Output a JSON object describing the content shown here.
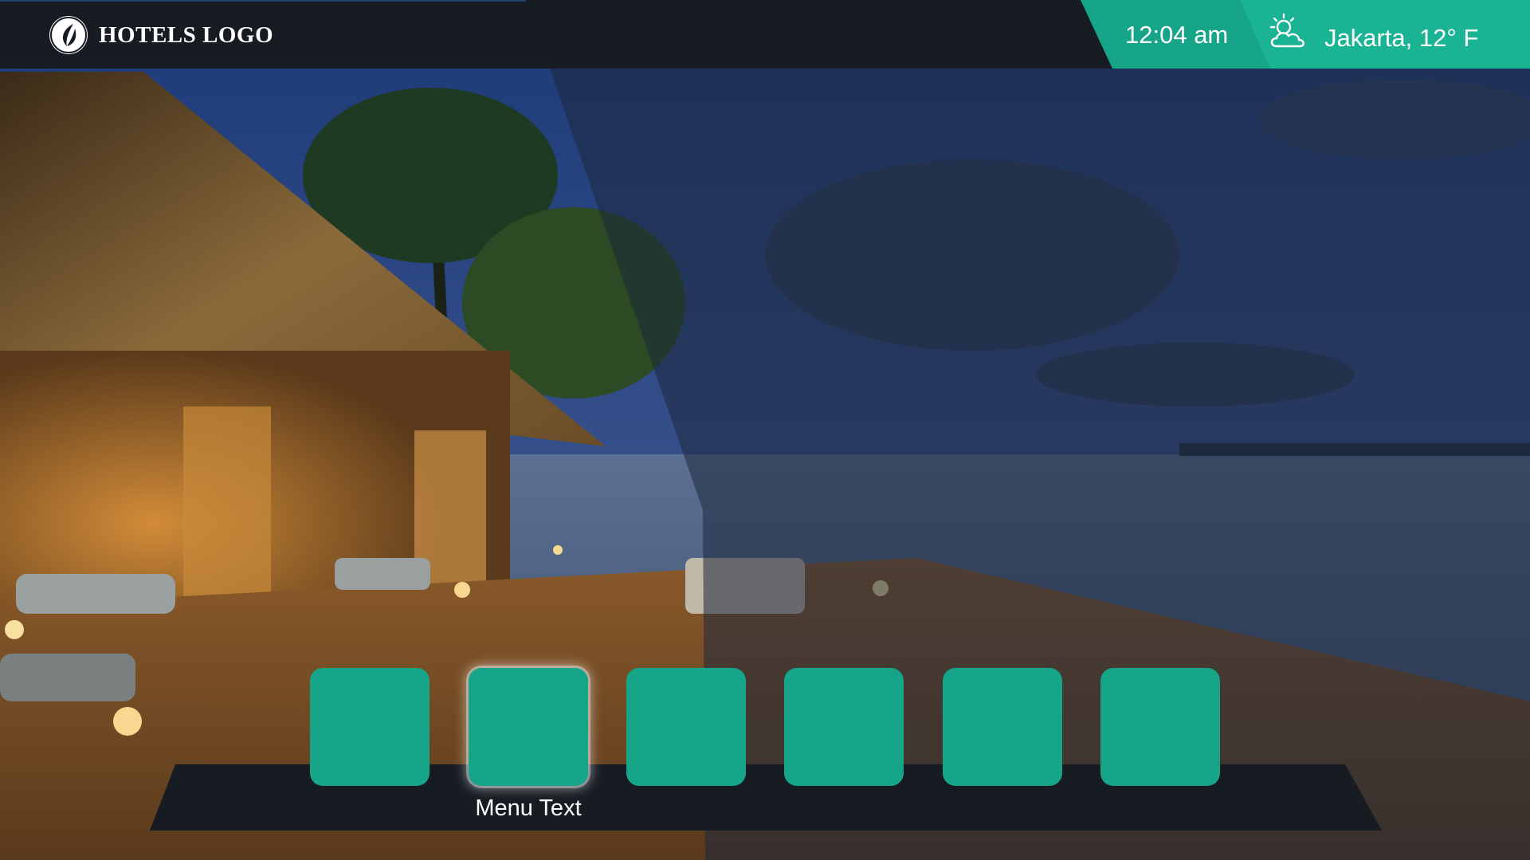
{
  "header": {
    "logo_text": "HOTELS LOGO",
    "logo_icon": "leaf-circle-icon",
    "time": "12:04 am",
    "weather_icon": "sun-cloud-icon",
    "weather_text": "Jakarta, 12° F"
  },
  "menu": {
    "selected_label": "Menu Text",
    "tile_count_note": "",
    "tiles": [
      {
        "focused": false
      },
      {
        "focused": true
      },
      {
        "focused": false
      },
      {
        "focused": false
      },
      {
        "focused": false
      },
      {
        "focused": false
      }
    ]
  },
  "colors": {
    "accent": "#17a58a",
    "bar": "#161c22",
    "text": "#ffffff"
  }
}
